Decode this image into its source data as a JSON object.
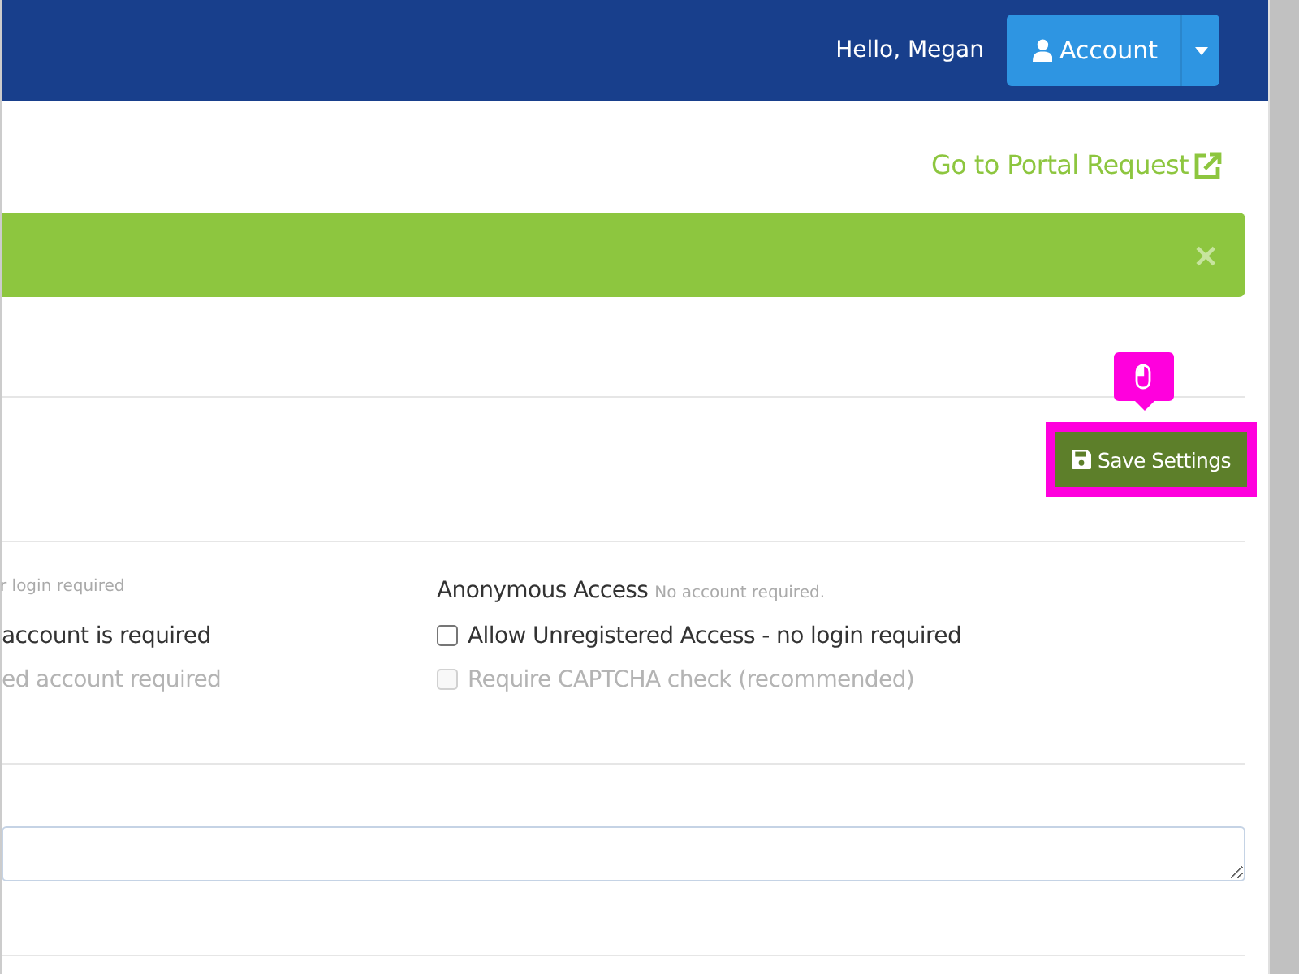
{
  "header": {
    "greeting": "Hello, Megan",
    "account_button": "Account"
  },
  "links": [
    {
      "label": "Go to Portal Request",
      "kind": "external"
    }
  ],
  "banner": {
    "close": "×"
  },
  "save_button": {
    "label": "Save Settings",
    "highlighted": true
  },
  "access": {
    "left": {
      "note": "r login required",
      "options": [
        {
          "label": "account is required",
          "disabled": false
        },
        {
          "label": "ed account required",
          "disabled": true
        }
      ]
    },
    "right": {
      "title": "Anonymous Access",
      "note": "No account required.",
      "options": [
        {
          "label": "Allow Unregistered Access - no login required",
          "checked": false,
          "disabled": false
        },
        {
          "label": "Require CAPTCHA check (recommended)",
          "checked": false,
          "disabled": true
        }
      ]
    }
  }
}
